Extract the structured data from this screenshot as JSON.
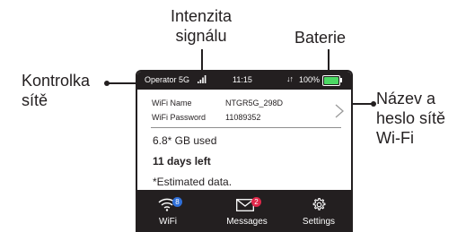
{
  "callouts": {
    "signal": [
      "Intenzita",
      "signálu"
    ],
    "battery": "Baterie",
    "network": [
      "Kontrolka",
      "sítě"
    ],
    "wifi": [
      "Název a",
      "heslo sítě",
      "Wi-Fi"
    ]
  },
  "status_bar": {
    "operator": "Operator 5G",
    "time": "11:15",
    "battery_percent": "100%",
    "battery_level": 1.0,
    "battery_color": "#4cd964"
  },
  "wifi": {
    "name_label": "WiFi Name",
    "name_value": "NTGR5G_298D",
    "password_label": "WiFi Password",
    "password_value": "11089352"
  },
  "usage": {
    "used": "6.8* GB used",
    "days_left": "11 days left",
    "note": "*Estimated data."
  },
  "tabs": {
    "wifi": {
      "label": "WiFi",
      "badge": "8",
      "badge_color": "#2f6fd8",
      "icon": "wifi-icon"
    },
    "messages": {
      "label": "Messages",
      "badge": "2",
      "badge_color": "#e0284a",
      "icon": "envelope-icon"
    },
    "settings": {
      "label": "Settings",
      "icon": "gear-icon"
    }
  },
  "colors": {
    "dark": "#231f20",
    "battery": "#4cd964"
  }
}
